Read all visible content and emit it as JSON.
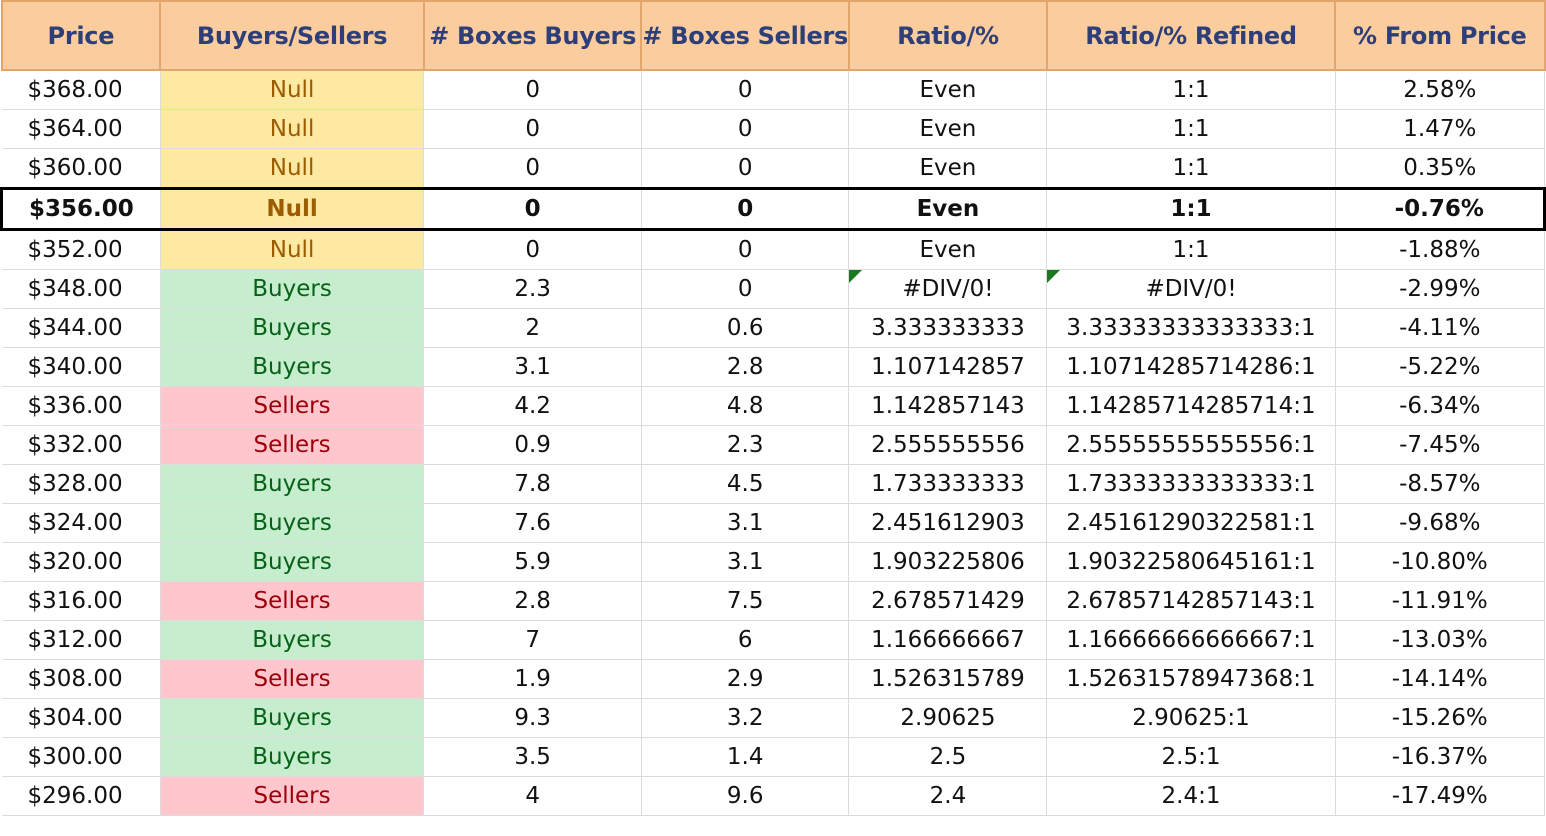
{
  "headers": [
    "Price",
    "Buyers/Sellers",
    "# Boxes Buyers",
    "# Boxes Sellers",
    "Ratio/%",
    "Ratio/% Refined",
    "% From Price"
  ],
  "current_price_row_index": 3,
  "rows": [
    {
      "price": "$368.00",
      "side": "Null",
      "boxes_buyers": "0",
      "boxes_sellers": "0",
      "ratio": "Even",
      "ratio_refined": "1:1",
      "from_price": "2.58%",
      "error": false
    },
    {
      "price": "$364.00",
      "side": "Null",
      "boxes_buyers": "0",
      "boxes_sellers": "0",
      "ratio": "Even",
      "ratio_refined": "1:1",
      "from_price": "1.47%",
      "error": false
    },
    {
      "price": "$360.00",
      "side": "Null",
      "boxes_buyers": "0",
      "boxes_sellers": "0",
      "ratio": "Even",
      "ratio_refined": "1:1",
      "from_price": "0.35%",
      "error": false
    },
    {
      "price": "$356.00",
      "side": "Null",
      "boxes_buyers": "0",
      "boxes_sellers": "0",
      "ratio": "Even",
      "ratio_refined": "1:1",
      "from_price": "-0.76%",
      "error": false
    },
    {
      "price": "$352.00",
      "side": "Null",
      "boxes_buyers": "0",
      "boxes_sellers": "0",
      "ratio": "Even",
      "ratio_refined": "1:1",
      "from_price": "-1.88%",
      "error": false
    },
    {
      "price": "$348.00",
      "side": "Buyers",
      "boxes_buyers": "2.3",
      "boxes_sellers": "0",
      "ratio": "#DIV/0!",
      "ratio_refined": "#DIV/0!",
      "from_price": "-2.99%",
      "error": true
    },
    {
      "price": "$344.00",
      "side": "Buyers",
      "boxes_buyers": "2",
      "boxes_sellers": "0.6",
      "ratio": "3.333333333",
      "ratio_refined": "3.33333333333333:1",
      "from_price": "-4.11%",
      "error": false
    },
    {
      "price": "$340.00",
      "side": "Buyers",
      "boxes_buyers": "3.1",
      "boxes_sellers": "2.8",
      "ratio": "1.107142857",
      "ratio_refined": "1.10714285714286:1",
      "from_price": "-5.22%",
      "error": false
    },
    {
      "price": "$336.00",
      "side": "Sellers",
      "boxes_buyers": "4.2",
      "boxes_sellers": "4.8",
      "ratio": "1.142857143",
      "ratio_refined": "1.14285714285714:1",
      "from_price": "-6.34%",
      "error": false
    },
    {
      "price": "$332.00",
      "side": "Sellers",
      "boxes_buyers": "0.9",
      "boxes_sellers": "2.3",
      "ratio": "2.555555556",
      "ratio_refined": "2.55555555555556:1",
      "from_price": "-7.45%",
      "error": false
    },
    {
      "price": "$328.00",
      "side": "Buyers",
      "boxes_buyers": "7.8",
      "boxes_sellers": "4.5",
      "ratio": "1.733333333",
      "ratio_refined": "1.73333333333333:1",
      "from_price": "-8.57%",
      "error": false
    },
    {
      "price": "$324.00",
      "side": "Buyers",
      "boxes_buyers": "7.6",
      "boxes_sellers": "3.1",
      "ratio": "2.451612903",
      "ratio_refined": "2.45161290322581:1",
      "from_price": "-9.68%",
      "error": false
    },
    {
      "price": "$320.00",
      "side": "Buyers",
      "boxes_buyers": "5.9",
      "boxes_sellers": "3.1",
      "ratio": "1.903225806",
      "ratio_refined": "1.90322580645161:1",
      "from_price": "-10.80%",
      "error": false
    },
    {
      "price": "$316.00",
      "side": "Sellers",
      "boxes_buyers": "2.8",
      "boxes_sellers": "7.5",
      "ratio": "2.678571429",
      "ratio_refined": "2.67857142857143:1",
      "from_price": "-11.91%",
      "error": false
    },
    {
      "price": "$312.00",
      "side": "Buyers",
      "boxes_buyers": "7",
      "boxes_sellers": "6",
      "ratio": "1.166666667",
      "ratio_refined": "1.16666666666667:1",
      "from_price": "-13.03%",
      "error": false
    },
    {
      "price": "$308.00",
      "side": "Sellers",
      "boxes_buyers": "1.9",
      "boxes_sellers": "2.9",
      "ratio": "1.526315789",
      "ratio_refined": "1.52631578947368:1",
      "from_price": "-14.14%",
      "error": false
    },
    {
      "price": "$304.00",
      "side": "Buyers",
      "boxes_buyers": "9.3",
      "boxes_sellers": "3.2",
      "ratio": "2.90625",
      "ratio_refined": "2.90625:1",
      "from_price": "-15.26%",
      "error": false
    },
    {
      "price": "$300.00",
      "side": "Buyers",
      "boxes_buyers": "3.5",
      "boxes_sellers": "1.4",
      "ratio": "2.5",
      "ratio_refined": "2.5:1",
      "from_price": "-16.37%",
      "error": false
    },
    {
      "price": "$296.00",
      "side": "Sellers",
      "boxes_buyers": "4",
      "boxes_sellers": "9.6",
      "ratio": "2.4",
      "ratio_refined": "2.4:1",
      "from_price": "-17.49%",
      "error": false
    }
  ],
  "colors": {
    "header_bg": "#fbcd9e",
    "header_text": "#2e3e78",
    "null_bg": "#fde9a2",
    "null_text": "#9c5c00",
    "buyers_bg": "#c6eece",
    "buyers_text": "#076118",
    "sellers_bg": "#ffc6ce",
    "sellers_text": "#9b0009"
  }
}
